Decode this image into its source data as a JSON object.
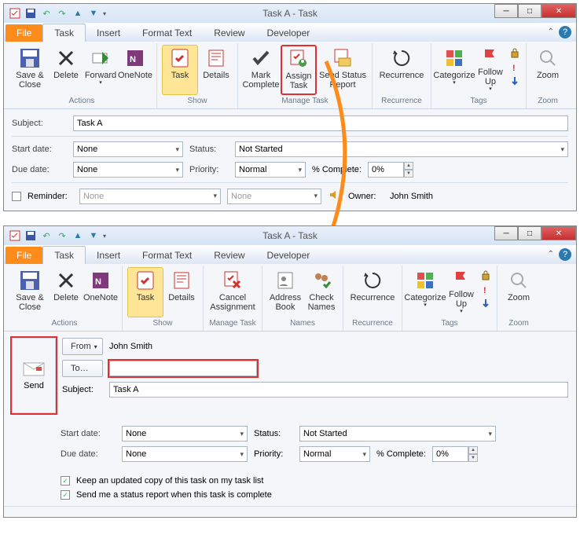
{
  "window1": {
    "title": "Task A  -  Task",
    "tabs": {
      "file": "File",
      "task": "Task",
      "insert": "Insert",
      "format": "Format Text",
      "review": "Review",
      "developer": "Developer"
    },
    "ribbon": {
      "saveClose": "Save &\nClose",
      "delete": "Delete",
      "forward": "Forward",
      "onenote": "OneNote",
      "task": "Task",
      "details": "Details",
      "markComplete": "Mark\nComplete",
      "assignTask": "Assign\nTask",
      "sendStatus": "Send Status\nReport",
      "recurrence": "Recurrence",
      "categorize": "Categorize",
      "followUp": "Follow\nUp",
      "zoom": "Zoom",
      "groups": {
        "actions": "Actions",
        "show": "Show",
        "manage": "Manage Task",
        "recurrence": "Recurrence",
        "tags": "Tags",
        "zoom": "Zoom"
      }
    },
    "form": {
      "subjectLabel": "Subject:",
      "subjectValue": "Task A",
      "startLabel": "Start date:",
      "startValue": "None",
      "dueLabel": "Due date:",
      "dueValue": "None",
      "statusLabel": "Status:",
      "statusValue": "Not Started",
      "priorityLabel": "Priority:",
      "priorityValue": "Normal",
      "pctLabel": "% Complete:",
      "pctValue": "0%",
      "reminderLabel": "Reminder:",
      "reminderDate": "None",
      "reminderTime": "None",
      "ownerLabel": "Owner:",
      "ownerValue": "John Smith"
    }
  },
  "window2": {
    "title": "Task A  -  Task",
    "tabs": {
      "file": "File",
      "task": "Task",
      "insert": "Insert",
      "format": "Format Text",
      "review": "Review",
      "developer": "Developer"
    },
    "ribbon": {
      "saveClose": "Save &\nClose",
      "delete": "Delete",
      "onenote": "OneNote",
      "task": "Task",
      "details": "Details",
      "cancelAssign": "Cancel\nAssignment",
      "addressBook": "Address\nBook",
      "checkNames": "Check\nNames",
      "recurrence": "Recurrence",
      "categorize": "Categorize",
      "followUp": "Follow\nUp",
      "zoom": "Zoom",
      "groups": {
        "actions": "Actions",
        "show": "Show",
        "manage": "Manage Task",
        "names": "Names",
        "recurrence": "Recurrence",
        "tags": "Tags",
        "zoom": "Zoom"
      }
    },
    "top": {
      "send": "Send",
      "from": "From",
      "fromValue": "John Smith",
      "to": "To…",
      "toValue": "",
      "subjectLabel": "Subject:",
      "subjectValue": "Task A"
    },
    "form": {
      "startLabel": "Start date:",
      "startValue": "None",
      "dueLabel": "Due date:",
      "dueValue": "None",
      "statusLabel": "Status:",
      "statusValue": "Not Started",
      "priorityLabel": "Priority:",
      "priorityValue": "Normal",
      "pctLabel": "% Complete:",
      "pctValue": "0%",
      "chk1": "Keep an updated copy of this task on my task list",
      "chk2": "Send me a status report when this task is complete"
    }
  }
}
